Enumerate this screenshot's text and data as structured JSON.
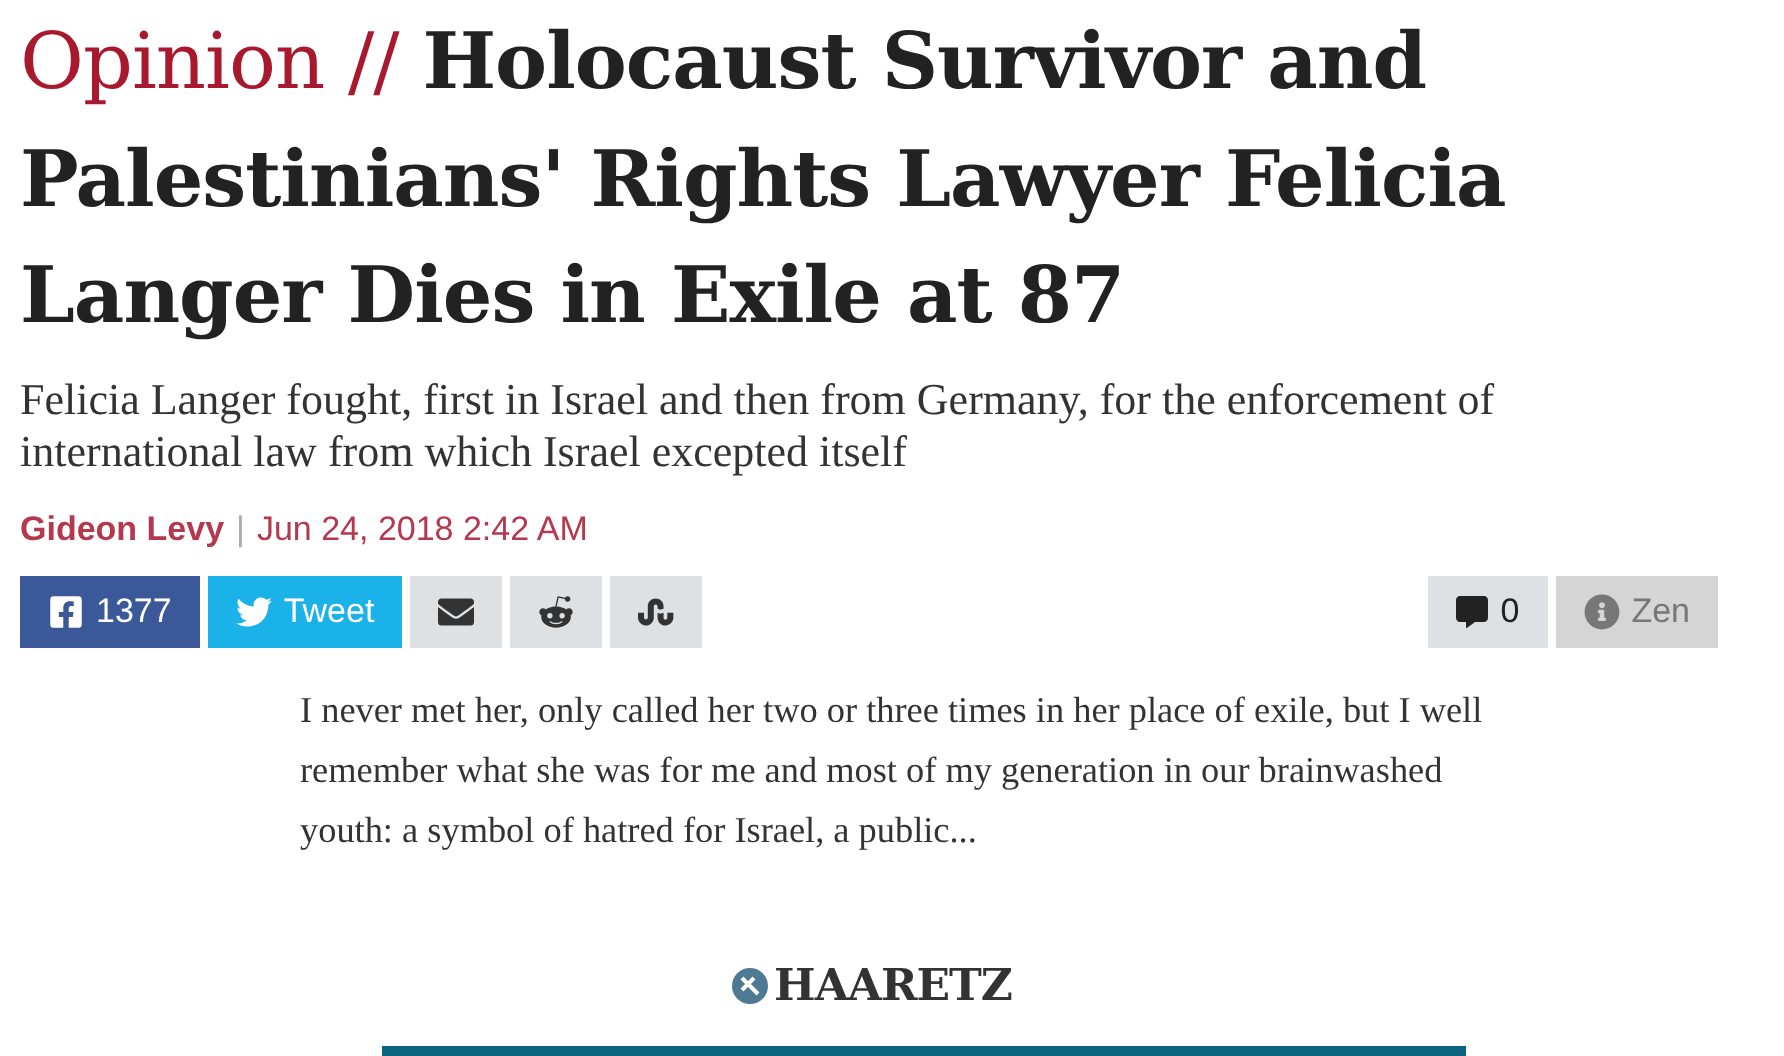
{
  "headline": {
    "section": "Opinion",
    "separator": "//",
    "title": "Holocaust Survivor and Palestinians' Rights Lawyer Felicia Langer Dies in Exile at 87"
  },
  "subtitle": "Felicia Langer fought, first in Israel and then from Germany, for the enforcement of international law from which Israel excepted itself",
  "byline": {
    "author": "Gideon Levy",
    "separator": "|",
    "date": "Jun 24, 2018 2:42 AM"
  },
  "share_buttons": [
    {
      "kind": "facebook",
      "label": "1377"
    },
    {
      "kind": "twitter",
      "label": "Tweet"
    },
    {
      "kind": "email"
    },
    {
      "kind": "reddit"
    },
    {
      "kind": "stumbleupon"
    }
  ],
  "comments": {
    "label": "0"
  },
  "zen": {
    "label": "Zen",
    "disabled": true
  },
  "excerpt": "I never met her, only called her two or three times in her place of exile, but I well remember what she was for me and most of my generation in our brainwashed youth: a symbol of hatred for Israel, a public...",
  "logo": {
    "label": "HAARETZ"
  }
}
